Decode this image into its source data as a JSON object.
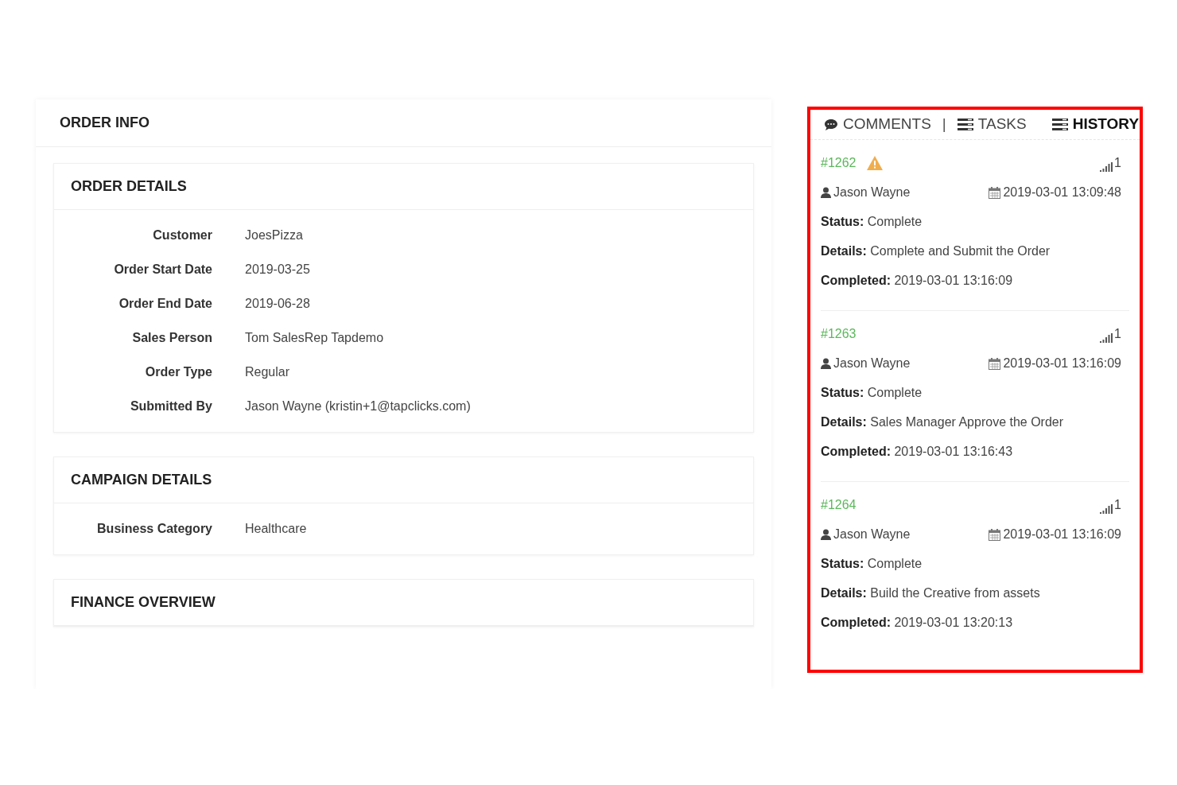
{
  "order_info": {
    "title": "ORDER INFO",
    "sections": [
      {
        "title": "ORDER DETAILS",
        "fields": [
          {
            "label": "Customer",
            "value": "JoesPizza"
          },
          {
            "label": "Order Start Date",
            "value": "2019-03-25"
          },
          {
            "label": "Order End Date",
            "value": "2019-06-28"
          },
          {
            "label": "Sales Person",
            "value": "Tom SalesRep Tapdemo"
          },
          {
            "label": "Order Type",
            "value": "Regular"
          },
          {
            "label": "Submitted By",
            "value": "Jason Wayne (kristin+1@tapclicks.com)"
          }
        ]
      },
      {
        "title": "CAMPAIGN DETAILS",
        "fields": [
          {
            "label": "Business Category",
            "value": "Healthcare"
          }
        ]
      },
      {
        "title": "FINANCE OVERVIEW"
      }
    ]
  },
  "side_panel": {
    "highlighted": true,
    "tabs": [
      {
        "label": "COMMENTS",
        "selected": false,
        "kind": "comments"
      },
      {
        "label": "TASKS",
        "selected": false,
        "kind": "tasks"
      },
      {
        "label": "HISTORY",
        "selected": true,
        "kind": "history"
      }
    ],
    "separator": "|",
    "entries": [
      {
        "id": "#1262",
        "warning": true,
        "priority": "1",
        "user": "Jason Wayne",
        "date": "2019-03-01 13:09:48",
        "status_label": "Status:",
        "status": "Complete",
        "details_label": "Details:",
        "details": "Complete and Submit the Order",
        "completed_label": "Completed:",
        "completed": "2019-03-01 13:16:09"
      },
      {
        "id": "#1263",
        "warning": false,
        "priority": "1",
        "user": "Jason Wayne",
        "date": "2019-03-01 13:16:09",
        "status_label": "Status:",
        "status": "Complete",
        "details_label": "Details:",
        "details": "Sales Manager Approve the Order",
        "completed_label": "Completed:",
        "completed": "2019-03-01 13:16:43"
      },
      {
        "id": "#1264",
        "warning": false,
        "priority": "1",
        "user": "Jason Wayne",
        "date": "2019-03-01 13:16:09",
        "status_label": "Status:",
        "status": "Complete",
        "details_label": "Details:",
        "details": "Build the Creative from assets",
        "completed_label": "Completed:",
        "completed": "2019-03-01 13:20:13"
      }
    ]
  }
}
